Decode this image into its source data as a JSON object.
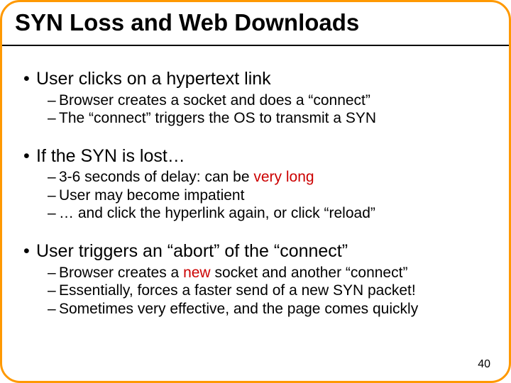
{
  "title": "SYN Loss and Web Downloads",
  "bullets": {
    "b1": {
      "text": "User clicks on a hypertext link"
    },
    "b1s": {
      "s1": "Browser creates a socket and does a “connect”",
      "s2": "The “connect” triggers the OS to transmit a SYN"
    },
    "b2": {
      "text": "If the SYN is lost…"
    },
    "b2s": {
      "s1_pre": "3-6 seconds of delay: can be ",
      "s1_hl": "very long",
      "s2": "User may become impatient",
      "s3": "… and click the hyperlink again, or click “reload”"
    },
    "b3": {
      "text": "User triggers an “abort” of the “connect”"
    },
    "b3s": {
      "s1_pre": "Browser creates a ",
      "s1_hl": "new",
      "s1_post": " socket and another “connect”",
      "s2": "Essentially, forces a faster send of a new SYN packet!",
      "s3": "Sometimes very effective, and the page comes quickly"
    }
  },
  "page_number": "40",
  "colors": {
    "accent_border": "#ff9900",
    "highlight": "#cc0000"
  }
}
